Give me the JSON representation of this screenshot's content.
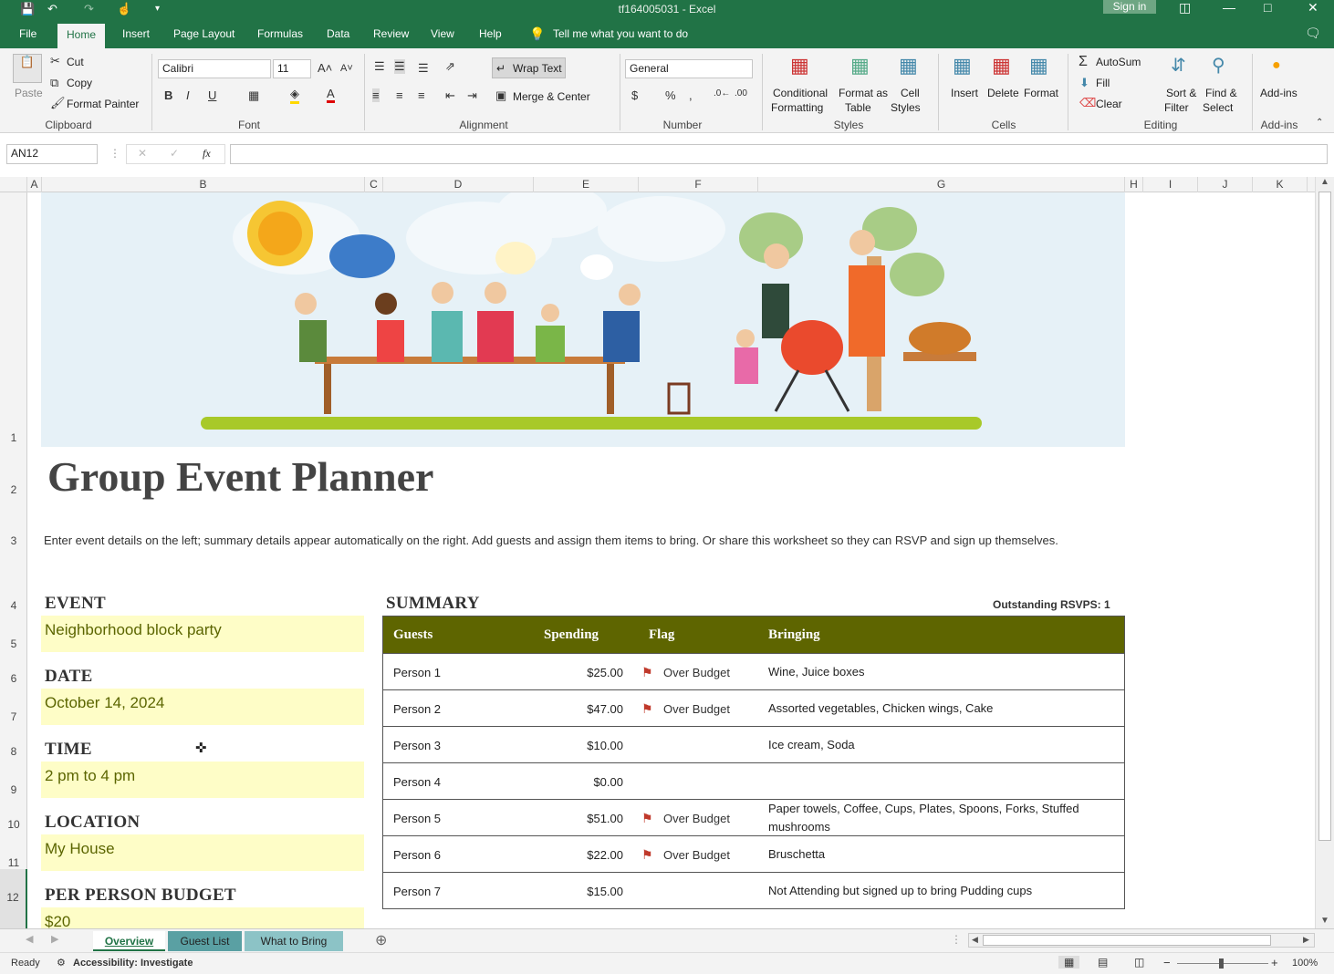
{
  "titlebar": {
    "title": "tf164005031  -  Excel",
    "signin": "Sign in"
  },
  "tabs": [
    "File",
    "Home",
    "Insert",
    "Page Layout",
    "Formulas",
    "Data",
    "Review",
    "View",
    "Help"
  ],
  "tell_me": "Tell me what you want to do",
  "ribbon": {
    "clipboard": {
      "paste": "Paste",
      "cut": "Cut",
      "copy": "Copy",
      "format_painter": "Format Painter",
      "label": "Clipboard"
    },
    "font": {
      "name": "Calibri",
      "size": "11",
      "label": "Font"
    },
    "alignment": {
      "wrap_text": "Wrap Text",
      "merge_center": "Merge & Center",
      "label": "Alignment"
    },
    "number": {
      "format": "General",
      "label": "Number"
    },
    "styles": {
      "conditional_line1": "Conditional",
      "conditional_line2": "Formatting",
      "format_table_line1": "Format as",
      "format_table_line2": "Table",
      "cell_styles_line1": "Cell",
      "cell_styles_line2": "Styles",
      "label": "Styles"
    },
    "cells": {
      "insert": "Insert",
      "delete": "Delete",
      "format": "Format",
      "label": "Cells"
    },
    "editing": {
      "autosum": "AutoSum",
      "fill": "Fill",
      "clear": "Clear",
      "sort_line1": "Sort &",
      "sort_line2": "Filter",
      "find_line1": "Find &",
      "find_line2": "Select",
      "label": "Editing"
    },
    "addins": {
      "button": "Add-ins",
      "label": "Add-ins"
    }
  },
  "formula_bar": {
    "name_box": "AN12",
    "fx": "fx",
    "formula": ""
  },
  "columns": [
    "A",
    "B",
    "C",
    "D",
    "E",
    "F",
    "G",
    "H",
    "I",
    "J",
    "K"
  ],
  "rows": [
    "1",
    "2",
    "3",
    "4",
    "5",
    "6",
    "7",
    "8",
    "9",
    "10",
    "11",
    "12"
  ],
  "sheet": {
    "title": "Group Event Planner",
    "description": "Enter event details on the left; summary details appear automatically on the right. Add guests and assign them items to bring. Or share this worksheet so they can RSVP and sign up themselves.",
    "event_label": "EVENT",
    "event_value": "Neighborhood block party",
    "date_label": "DATE",
    "date_value": "October 14, 2024",
    "time_label": "TIME",
    "time_value": "2 pm to 4 pm",
    "location_label": "LOCATION",
    "location_value": "My House",
    "budget_label": "PER PERSON BUDGET",
    "budget_value": "$20",
    "summary_label": "SUMMARY",
    "outstanding": "Outstanding RSVPS: 1"
  },
  "summary_table": {
    "headers": {
      "guests": "Guests",
      "spending": "Spending",
      "flag": "Flag",
      "bringing": "Bringing"
    },
    "rows": [
      {
        "guest": "Person 1",
        "spending": "$25.00",
        "flag": "Over Budget",
        "bringing": "Wine, Juice boxes"
      },
      {
        "guest": "Person 2",
        "spending": "$47.00",
        "flag": "Over Budget",
        "bringing": "Assorted vegetables, Chicken wings, Cake"
      },
      {
        "guest": "Person 3",
        "spending": "$10.00",
        "flag": "",
        "bringing": "Ice cream, Soda"
      },
      {
        "guest": "Person 4",
        "spending": "$0.00",
        "flag": "",
        "bringing": ""
      },
      {
        "guest": "Person 5",
        "spending": "$51.00",
        "flag": "Over Budget",
        "bringing": "Paper towels, Coffee, Cups, Plates, Spoons, Forks, Stuffed mushrooms"
      },
      {
        "guest": "Person 6",
        "spending": "$22.00",
        "flag": "Over Budget",
        "bringing": "Bruschetta"
      },
      {
        "guest": "Person 7",
        "spending": "$15.00",
        "flag": "",
        "bringing": "Not Attending but signed up to bring Pudding cups"
      }
    ]
  },
  "sheet_tabs": [
    "Overview",
    "Guest List",
    "What to Bring"
  ],
  "status": {
    "ready": "Ready",
    "accessibility": "Accessibility: Investigate",
    "zoom": "100%"
  },
  "colors": {
    "excel_green": "#217346",
    "header_olive": "#5e6500",
    "input_yellow": "#fefdc7",
    "flag_red": "#c0392b"
  }
}
